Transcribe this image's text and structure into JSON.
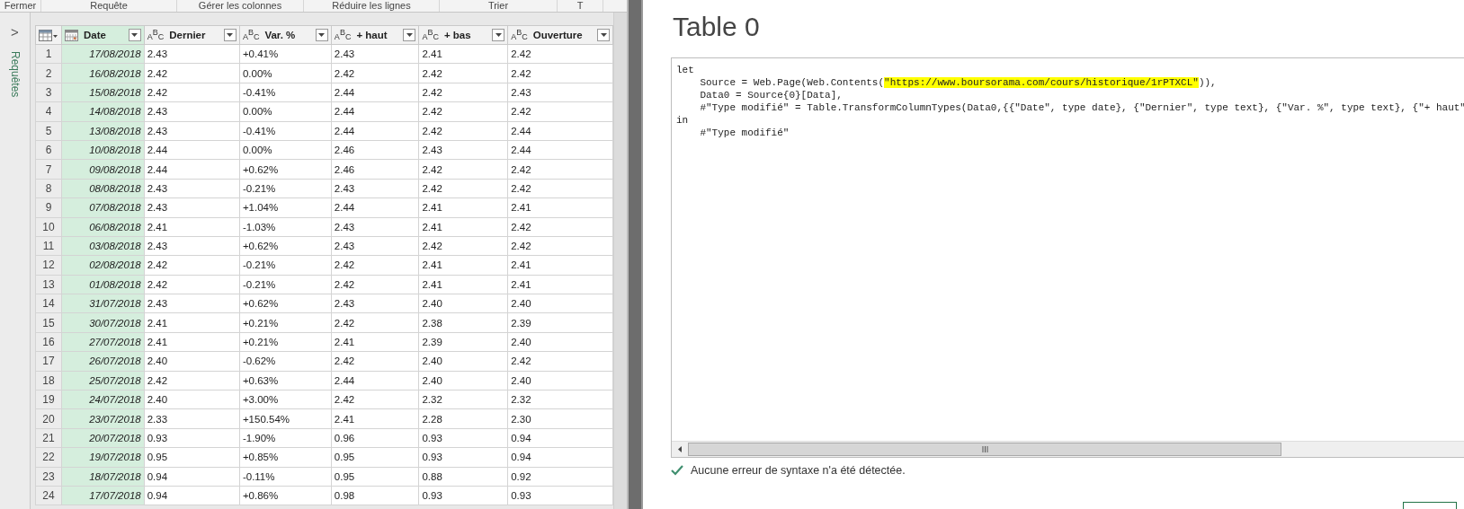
{
  "ribbon_groups": [
    "Fermer",
    "Requête",
    "Gérer les colonnes",
    "Réduire les lignes",
    "Trier",
    "T"
  ],
  "queries_pane": {
    "expand_glyph": ">",
    "label": "Requêtes"
  },
  "table": {
    "columns": [
      {
        "label": "Date",
        "kind": "date",
        "selected": true
      },
      {
        "label": "Dernier",
        "kind": "text",
        "type_letters": [
          "A",
          "B",
          "C"
        ],
        "selected": false
      },
      {
        "label": "Var. %",
        "kind": "text",
        "type_letters": [
          "A",
          "B",
          "C"
        ],
        "selected": false
      },
      {
        "label": "+ haut",
        "kind": "text",
        "type_letters": [
          "A",
          "B",
          "C"
        ],
        "selected": false
      },
      {
        "label": "+ bas",
        "kind": "text",
        "type_letters": [
          "A",
          "B",
          "C"
        ],
        "selected": false
      },
      {
        "label": "Ouverture",
        "kind": "text",
        "type_letters": [
          "A",
          "B",
          "C"
        ],
        "selected": false
      }
    ],
    "rows": [
      {
        "number": "1",
        "cells": [
          "17/08/2018",
          "2.43",
          "+0.41%",
          "2.43",
          "2.41",
          "2.42"
        ]
      },
      {
        "number": "2",
        "cells": [
          "16/08/2018",
          "2.42",
          "0.00%",
          "2.42",
          "2.42",
          "2.42"
        ]
      },
      {
        "number": "3",
        "cells": [
          "15/08/2018",
          "2.42",
          "-0.41%",
          "2.44",
          "2.42",
          "2.43"
        ]
      },
      {
        "number": "4",
        "cells": [
          "14/08/2018",
          "2.43",
          "0.00%",
          "2.44",
          "2.42",
          "2.42"
        ]
      },
      {
        "number": "5",
        "cells": [
          "13/08/2018",
          "2.43",
          "-0.41%",
          "2.44",
          "2.42",
          "2.44"
        ]
      },
      {
        "number": "6",
        "cells": [
          "10/08/2018",
          "2.44",
          "0.00%",
          "2.46",
          "2.43",
          "2.44"
        ]
      },
      {
        "number": "7",
        "cells": [
          "09/08/2018",
          "2.44",
          "+0.62%",
          "2.46",
          "2.42",
          "2.42"
        ]
      },
      {
        "number": "8",
        "cells": [
          "08/08/2018",
          "2.43",
          "-0.21%",
          "2.43",
          "2.42",
          "2.42"
        ]
      },
      {
        "number": "9",
        "cells": [
          "07/08/2018",
          "2.43",
          "+1.04%",
          "2.44",
          "2.41",
          "2.41"
        ]
      },
      {
        "number": "10",
        "cells": [
          "06/08/2018",
          "2.41",
          "-1.03%",
          "2.43",
          "2.41",
          "2.42"
        ]
      },
      {
        "number": "11",
        "cells": [
          "03/08/2018",
          "2.43",
          "+0.62%",
          "2.43",
          "2.42",
          "2.42"
        ]
      },
      {
        "number": "12",
        "cells": [
          "02/08/2018",
          "2.42",
          "-0.21%",
          "2.42",
          "2.41",
          "2.41"
        ]
      },
      {
        "number": "13",
        "cells": [
          "01/08/2018",
          "2.42",
          "-0.21%",
          "2.42",
          "2.41",
          "2.41"
        ]
      },
      {
        "number": "14",
        "cells": [
          "31/07/2018",
          "2.43",
          "+0.62%",
          "2.43",
          "2.40",
          "2.40"
        ]
      },
      {
        "number": "15",
        "cells": [
          "30/07/2018",
          "2.41",
          "+0.21%",
          "2.42",
          "2.38",
          "2.39"
        ]
      },
      {
        "number": "16",
        "cells": [
          "27/07/2018",
          "2.41",
          "+0.21%",
          "2.41",
          "2.39",
          "2.40"
        ]
      },
      {
        "number": "17",
        "cells": [
          "26/07/2018",
          "2.40",
          "-0.62%",
          "2.42",
          "2.40",
          "2.42"
        ]
      },
      {
        "number": "18",
        "cells": [
          "25/07/2018",
          "2.42",
          "+0.63%",
          "2.44",
          "2.40",
          "2.40"
        ]
      },
      {
        "number": "19",
        "cells": [
          "24/07/2018",
          "2.40",
          "+3.00%",
          "2.42",
          "2.32",
          "2.32"
        ]
      },
      {
        "number": "20",
        "cells": [
          "23/07/2018",
          "2.33",
          "+150.54%",
          "2.41",
          "2.28",
          "2.30"
        ]
      },
      {
        "number": "21",
        "cells": [
          "20/07/2018",
          "0.93",
          "-1.90%",
          "0.96",
          "0.93",
          "0.94"
        ]
      },
      {
        "number": "22",
        "cells": [
          "19/07/2018",
          "0.95",
          "+0.85%",
          "0.95",
          "0.93",
          "0.94"
        ]
      },
      {
        "number": "23",
        "cells": [
          "18/07/2018",
          "0.94",
          "-0.11%",
          "0.95",
          "0.88",
          "0.92"
        ]
      },
      {
        "number": "24",
        "cells": [
          "17/07/2018",
          "0.94",
          "+0.86%",
          "0.98",
          "0.93",
          "0.93"
        ]
      }
    ]
  },
  "editor": {
    "title": "Table 0",
    "code_lines": [
      [
        {
          "text": "let",
          "highlighted": false
        }
      ],
      [
        {
          "text": "    Source = Web.Page(Web.Contents(",
          "highlighted": false
        },
        {
          "text": "\"https://www.boursorama.com/cours/historique/1rPTXCL\"",
          "highlighted": true
        },
        {
          "text": ")),",
          "highlighted": false
        }
      ],
      [
        {
          "text": "    Data0 = Source{0}[Data],",
          "highlighted": false
        }
      ],
      [
        {
          "text": "    #\"Type modifié\" = Table.TransformColumnTypes(Data0,{{\"Date\", type date}, {\"Dernier\", type text}, {\"Var. %\", type text}, {\"+ haut\"",
          "highlighted": false
        }
      ],
      [
        {
          "text": "in",
          "highlighted": false
        }
      ],
      [
        {
          "text": "    #\"Type modifié\"",
          "highlighted": false
        }
      ]
    ],
    "status": {
      "ok": true,
      "message": "Aucune erreur de syntaxe n'a été détectée."
    }
  }
}
